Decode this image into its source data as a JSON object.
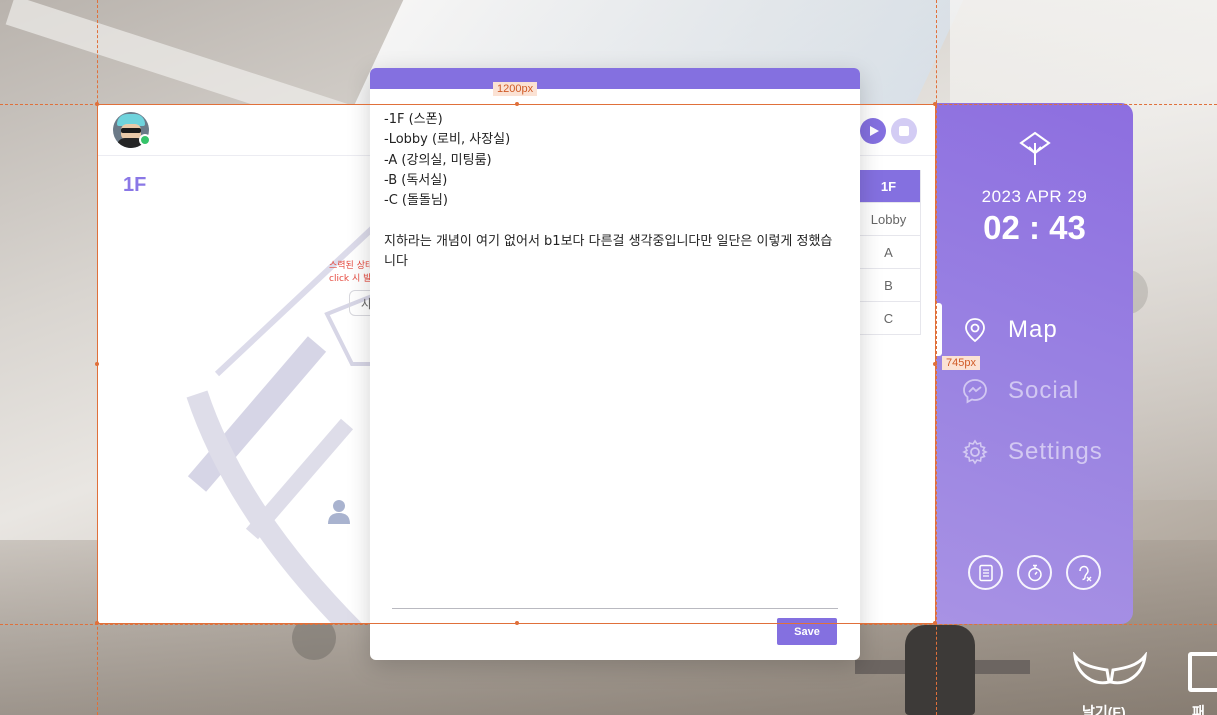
{
  "guides": {
    "width_label": "1200px",
    "height_label": "745px"
  },
  "map_panel": {
    "floor_title": "1F",
    "hint_line1": "스력된 상태",
    "hint_line2": "click 시 발",
    "search_partial": "사",
    "floors": [
      {
        "label": "1F",
        "active": true
      },
      {
        "label": "Lobby",
        "active": false
      },
      {
        "label": "A",
        "active": false
      },
      {
        "label": "B",
        "active": false
      },
      {
        "label": "C",
        "active": false
      }
    ]
  },
  "note_modal": {
    "content": "-1F (스폰)\n-Lobby (로비, 사장실)\n-A (강의실, 미팅룸)\n-B (독서실)\n-C (돌돌님)\n\n지하라는 개념이 여기 없어서 b1보다 다른걸 생각중입니다만 일단은 이렇게 정했습니다",
    "save_label": "Save"
  },
  "sidebar": {
    "date": "2023 APR 29",
    "time": "02 : 43",
    "nav": [
      {
        "label": "Map",
        "icon": "map-pin-icon",
        "active": true
      },
      {
        "label": "Social",
        "icon": "messenger-icon",
        "active": false
      },
      {
        "label": "Settings",
        "icon": "gear-icon",
        "active": false
      }
    ],
    "bottom_buttons": [
      "notes-icon",
      "stopwatch-icon",
      "hearing-off-icon"
    ]
  },
  "floating": {
    "wing_label": "날기(F)",
    "panel_label": "패널"
  },
  "colors": {
    "accent": "#8470e0",
    "sidebar_top": "#8d6ee0",
    "online": "#35c46a",
    "hint_red": "#e5483d"
  }
}
